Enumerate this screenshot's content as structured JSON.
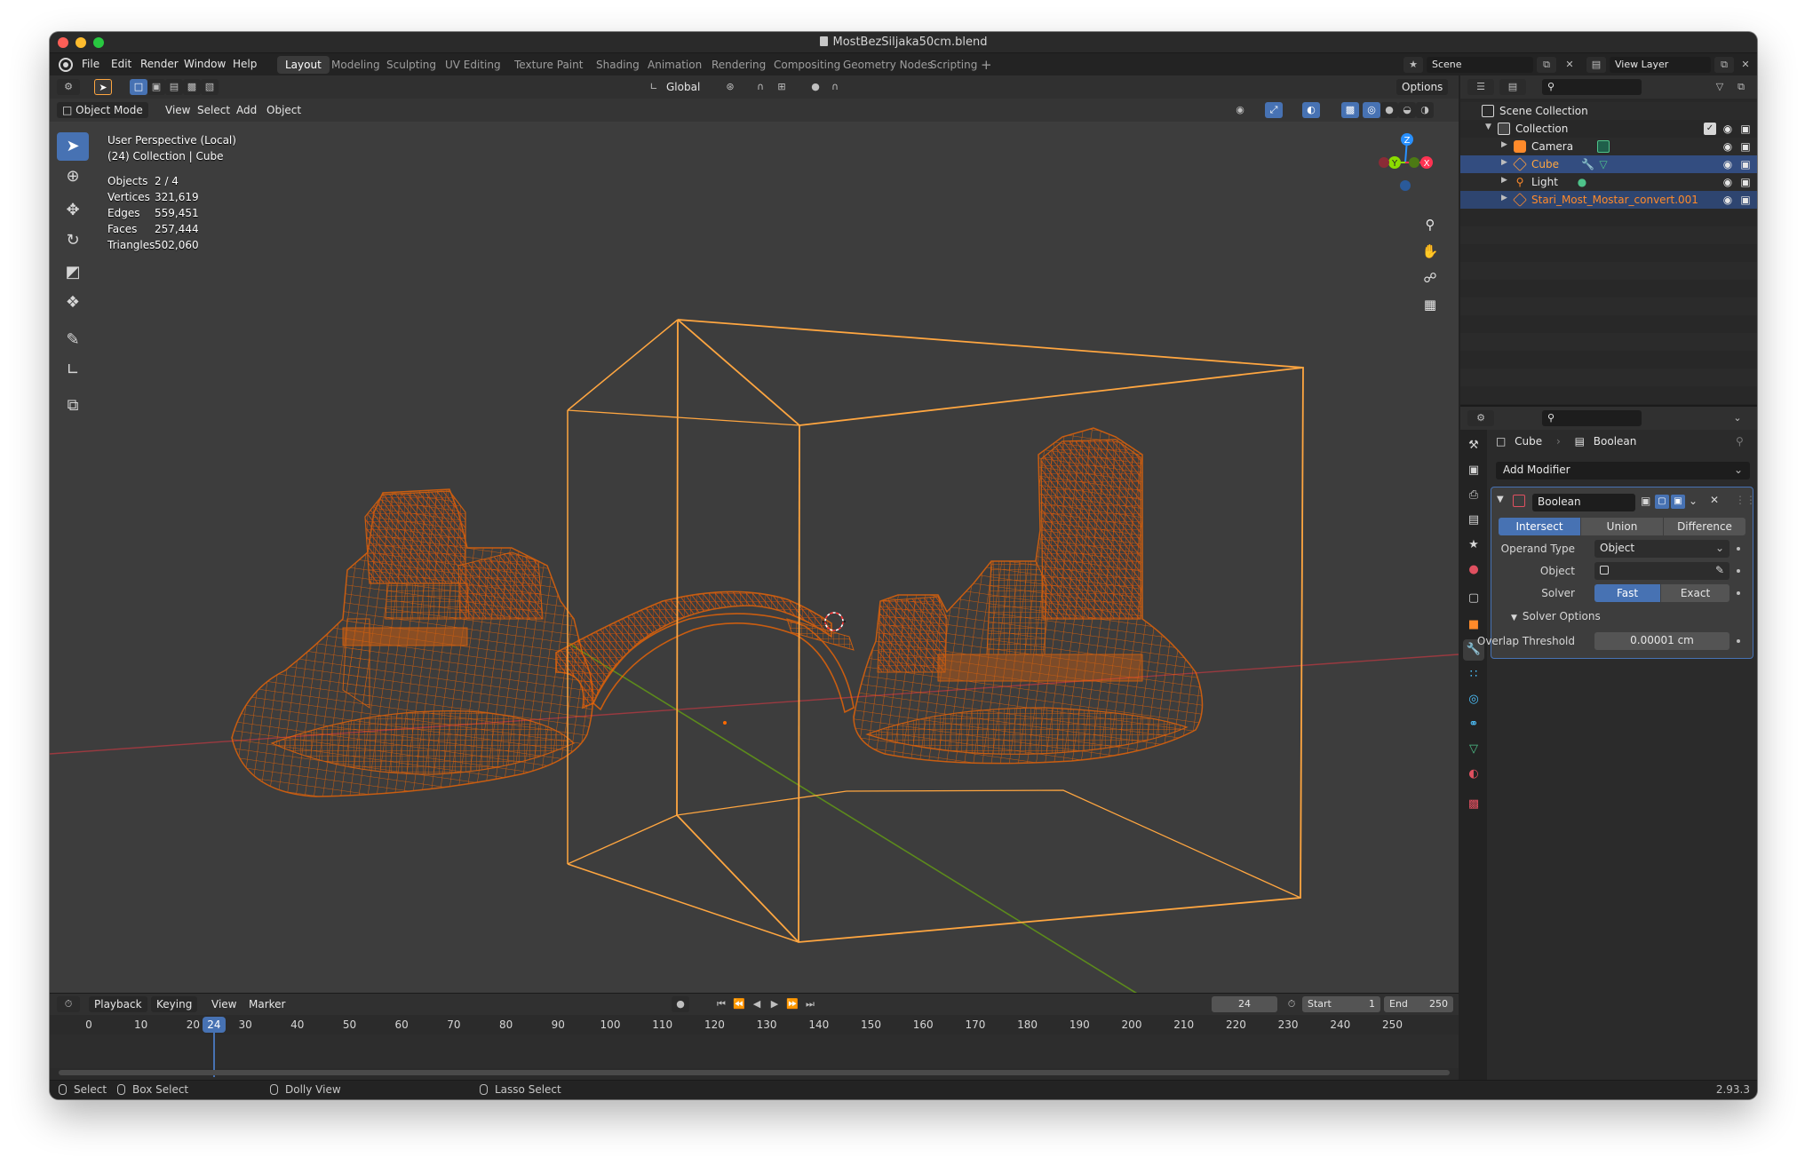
{
  "window": {
    "title": "MostBezSiljaka50cm.blend"
  },
  "menu": [
    "File",
    "Edit",
    "Render",
    "Window",
    "Help"
  ],
  "workspaces": [
    "Layout",
    "Modeling",
    "Sculpting",
    "UV Editing",
    "Texture Paint",
    "Shading",
    "Animation",
    "Rendering",
    "Compositing",
    "Geometry Nodes",
    "Scripting"
  ],
  "active_workspace": "Layout",
  "scene_name": "Scene",
  "view_layer": "View Layer",
  "header": {
    "orientation": "Global",
    "options": "Options",
    "mode": "Object Mode",
    "menus": [
      "View",
      "Select",
      "Add",
      "Object"
    ]
  },
  "viewport": {
    "perspective_label": "User Perspective (Local)",
    "collection_label": "(24) Collection | Cube",
    "stats": [
      {
        "key": "Objects",
        "value": "2 / 4"
      },
      {
        "key": "Vertices",
        "value": "321,619"
      },
      {
        "key": "Edges",
        "value": "559,451"
      },
      {
        "key": "Faces",
        "value": "257,444"
      },
      {
        "key": "Triangles",
        "value": "502,060"
      }
    ],
    "gizmo": {
      "z": "Z",
      "y": "Y",
      "x": "X"
    },
    "wireframe": {
      "layer_opacity": 0.72
    }
  },
  "timeline": {
    "menus": [
      "Playback",
      "Keying",
      "View",
      "Marker"
    ],
    "current_frame": "24",
    "start_label": "Start",
    "start": "1",
    "end_label": "End",
    "end": "250",
    "ticks": [
      "0",
      "10",
      "20",
      "30",
      "40",
      "50",
      "60",
      "70",
      "80",
      "90",
      "100",
      "110",
      "120",
      "130",
      "140",
      "150",
      "160",
      "170",
      "180",
      "190",
      "200",
      "210",
      "220",
      "230",
      "240",
      "250"
    ]
  },
  "status_bar": {
    "select": "Select",
    "box_select": "Box Select",
    "dolly_view": "Dolly View",
    "lasso_select": "Lasso Select",
    "version": "2.93.3"
  },
  "outliner": {
    "root": "Scene Collection",
    "collection": "Collection",
    "items": [
      {
        "name": "Camera",
        "selected": false,
        "color": "#e6e6e6"
      },
      {
        "name": "Cube",
        "selected": true,
        "color": "#ff9d3a"
      },
      {
        "name": "Light",
        "selected": false,
        "color": "#e6e6e6"
      },
      {
        "name": "Stari_Most_Mostar_convert.001",
        "selected": true,
        "color": "#ff8a2a"
      }
    ]
  },
  "properties": {
    "object": "Cube",
    "modifier_crumb": "Boolean",
    "add_modifier": "Add Modifier",
    "modifier": {
      "name": "Boolean",
      "operations": [
        "Intersect",
        "Union",
        "Difference"
      ],
      "active_operation": "Intersect",
      "operand_type_label": "Operand Type",
      "operand_type": "Object",
      "object_label": "Object",
      "object_value": "",
      "solver_label": "Solver",
      "solvers": [
        "Fast",
        "Exact"
      ],
      "active_solver": "Fast",
      "solver_options": "Solver Options",
      "overlap_label": "Overlap Threshold",
      "overlap_value": "0.00001 cm"
    }
  },
  "ui_colors": {
    "accent": "#4772b3",
    "selection_orange": "#ff6a00",
    "active_orange": "#ffa640",
    "x_axis": "#ff3352",
    "y_axis": "#8bdc00",
    "z_axis": "#2890ff"
  }
}
